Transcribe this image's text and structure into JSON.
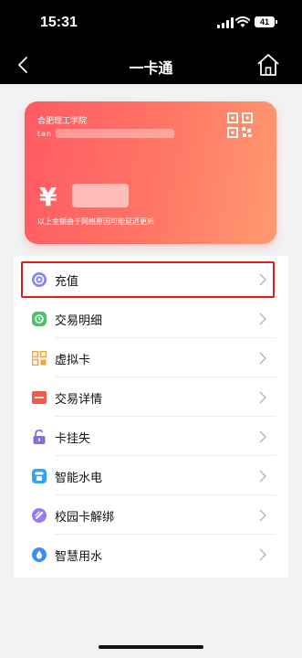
{
  "status_bar": {
    "time": "15:31",
    "battery": "41"
  },
  "nav": {
    "title": "一卡通"
  },
  "card": {
    "school": "合肥理工学院",
    "account_prefix": "tan",
    "currency": "¥",
    "note": "以上金额由于网络原因可能延迟更新"
  },
  "menu": {
    "items": [
      {
        "label": "充值",
        "icon": "recharge-icon",
        "color": "#7b7fe8"
      },
      {
        "label": "交易明细",
        "icon": "transaction-details-icon",
        "color": "#4cc36a"
      },
      {
        "label": "虚拟卡",
        "icon": "virtual-card-icon",
        "color": "#f1a23a"
      },
      {
        "label": "交易详情",
        "icon": "transaction-info-icon",
        "color": "#f05a4e"
      },
      {
        "label": "卡挂失",
        "icon": "lock-icon",
        "color": "#7b6ff0"
      },
      {
        "label": "智能水电",
        "icon": "utilities-icon",
        "color": "#36a3f0"
      },
      {
        "label": "校园卡解绑",
        "icon": "unbind-icon",
        "color": "#9a7bf0"
      },
      {
        "label": "智慧用水",
        "icon": "water-icon",
        "color": "#3a8ff0"
      }
    ]
  },
  "colors": {
    "accent": "#ff5a63",
    "highlight": "#e21d1d"
  }
}
